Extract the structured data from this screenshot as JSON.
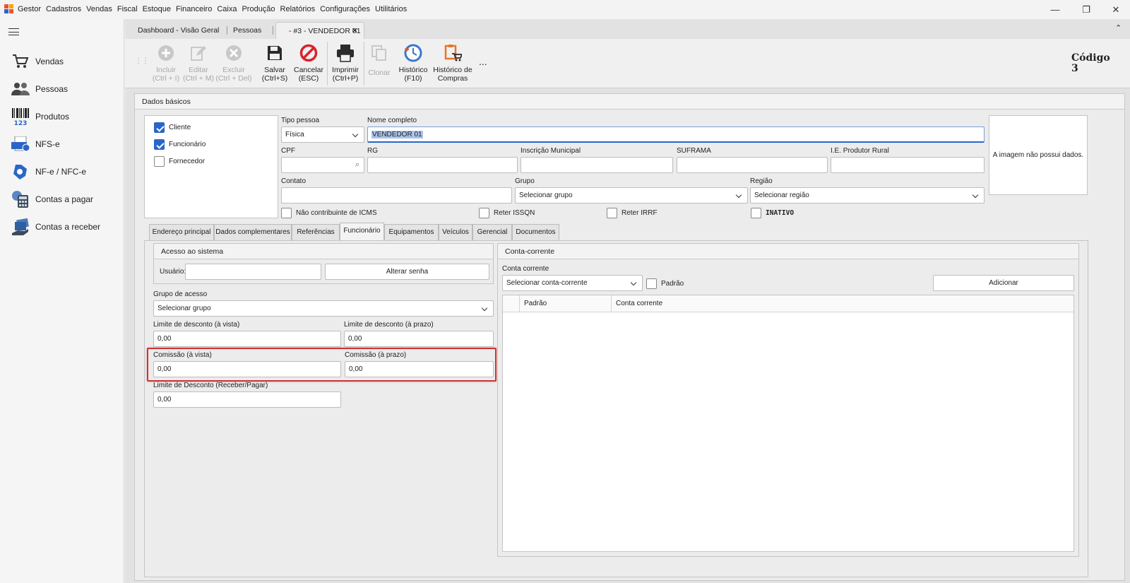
{
  "menubar": {
    "app": "Gestor",
    "items": [
      "Cadastros",
      "Vendas",
      "Fiscal",
      "Estoque",
      "Financeiro",
      "Caixa",
      "Produção",
      "Relatórios",
      "Configurações",
      "Utilitários"
    ]
  },
  "sidebar": {
    "items": [
      {
        "label": "Vendas",
        "icon": "cart-icon"
      },
      {
        "label": "Pessoas",
        "icon": "people-icon"
      },
      {
        "label": "Produtos",
        "icon": "barcode-icon"
      },
      {
        "label": "NFS-e",
        "icon": "nfse-icon"
      },
      {
        "label": "NF-e / NFC-e",
        "icon": "nfe-icon"
      },
      {
        "label": "Contas a pagar",
        "icon": "calculator-icon"
      },
      {
        "label": "Contas a receber",
        "icon": "money-hand-icon"
      }
    ]
  },
  "tabs": [
    "Dashboard - Visão Geral",
    "Pessoas",
    "- #3 - VENDEDOR 01"
  ],
  "toolbar": {
    "incluir": [
      "Incluir",
      "(Ctrl + I)"
    ],
    "editar": [
      "Editar",
      "(Ctrl + M)"
    ],
    "excluir": [
      "Excluir",
      "(Ctrl + Del)"
    ],
    "salvar": [
      "Salvar",
      "(Ctrl+S)"
    ],
    "cancelar": [
      "Cancelar",
      "(ESC)"
    ],
    "imprimir": [
      "Imprimir",
      "(Ctrl+P)"
    ],
    "clonar": "Clonar",
    "historico": [
      "Histórico",
      "(F10)"
    ],
    "historico_compras": [
      "Histórico de",
      "Compras"
    ],
    "more": "...",
    "codigo_label": "Código",
    "codigo_value": "3"
  },
  "dados_basicos": {
    "title": "Dados básicos",
    "cliente": "Cliente",
    "funcionario": "Funcionário",
    "fornecedor": "Fornecedor",
    "tipo_pessoa_label": "Tipo pessoa",
    "tipo_pessoa_value": "Física",
    "nome_label": "Nome completo",
    "nome_value": "VENDEDOR 01",
    "cpf_label": "CPF",
    "rg_label": "RG",
    "im_label": "Inscrição Municipal",
    "suframa_label": "SUFRAMA",
    "ie_label": "I.E. Produtor Rural",
    "contato_label": "Contato",
    "grupo_label": "Grupo",
    "grupo_value": "Selecionar grupo",
    "regiao_label": "Região",
    "regiao_value": "Selecionar região",
    "nao_contribuinte": "Não contribuinte de ICMS",
    "reter_issqn": "Reter ISSQN",
    "reter_irrf": "Reter IRRF",
    "inativo": "INATIVO",
    "imagem": "A imagem não possui dados."
  },
  "subtabs": [
    "Endereço principal",
    "Dados complementares",
    "Referências",
    "Funcionário",
    "Equipamentos",
    "Veículos",
    "Gerencial",
    "Documentos"
  ],
  "funcionario": {
    "acesso_title": "Acesso ao sistema",
    "usuario_label": "Usuário:",
    "alterar_senha": "Alterar senha",
    "grupo_acesso_label": "Grupo de acesso",
    "grupo_acesso_value": "Selecionar grupo",
    "lim_vista_label": "Limite de desconto (à vista)",
    "lim_vista_value": "0,00",
    "lim_prazo_label": "Limite de desconto (à prazo)",
    "lim_prazo_value": "0,00",
    "com_vista_label": "Comissão (à vista)",
    "com_vista_value": "0,00",
    "com_prazo_label": "Comissão (à prazo)",
    "com_prazo_value": "0,00",
    "lim_receber_label": "Limite de Desconto (Receber/Pagar)",
    "lim_receber_value": "0,00"
  },
  "conta_corrente": {
    "title": "Conta-corrente",
    "label": "Conta corrente",
    "select_value": "Selecionar conta-corrente",
    "padrao": "Padrão",
    "adicionar": "Adicionar",
    "col_padrao": "Padrão",
    "col_conta": "Conta corrente"
  },
  "colors": {
    "accent": "#2a66c8",
    "highlight": "#cc3333",
    "cancel": "#d9232d"
  }
}
